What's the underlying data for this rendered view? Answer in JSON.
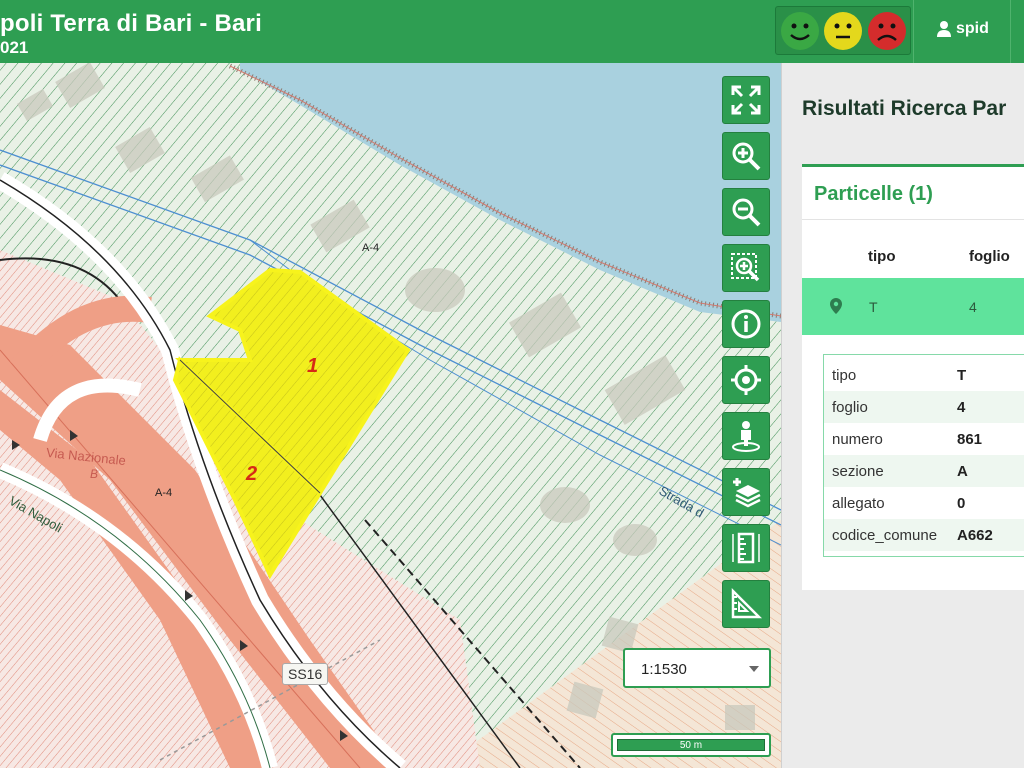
{
  "header": {
    "title": "poli Terra di Bari - Bari",
    "subtitle": "021",
    "user_label": "spid",
    "feedback": {
      "good_color": "#3aa844",
      "neutral_color": "#e4d81c",
      "bad_color": "#d42c2c"
    }
  },
  "map": {
    "labels": {
      "zone_a4_top": "A-4",
      "zone_a4_left": "A-4",
      "via_nazionale": "Via Nazionale",
      "via_nazionale_b": "B",
      "via_napoli": "Via Napoli",
      "strada": "Strada d",
      "road_badge": "SS16"
    },
    "parcels": [
      {
        "number": "1",
        "fill": "#f2ef1e"
      },
      {
        "number": "2",
        "fill": "#f2ef1e"
      }
    ],
    "tools": [
      {
        "name": "fullscreen",
        "icon": "expand-icon"
      },
      {
        "name": "zoom-in",
        "icon": "zoom-in-icon"
      },
      {
        "name": "zoom-out",
        "icon": "zoom-out-icon"
      },
      {
        "name": "zoom-selection",
        "icon": "zoom-box-icon"
      },
      {
        "name": "info",
        "icon": "info-icon"
      },
      {
        "name": "locate",
        "icon": "locate-icon"
      },
      {
        "name": "street-view",
        "icon": "person-pin-icon"
      },
      {
        "name": "add-layer",
        "icon": "layers-add-icon"
      },
      {
        "name": "measure-length",
        "icon": "ruler-icon"
      },
      {
        "name": "measure-area",
        "icon": "set-square-icon"
      }
    ],
    "scale_select": {
      "value": "1:1530"
    },
    "scale_bar": {
      "label": "50 m"
    }
  },
  "panel": {
    "title": "Risultati Ricerca Par",
    "card_title": "Particelle (1)",
    "columns": [
      "tipo",
      "foglio"
    ],
    "selected_row": {
      "tipo": "T",
      "foglio": "4"
    },
    "details": [
      {
        "key": "tipo",
        "value": "T"
      },
      {
        "key": "foglio",
        "value": "4"
      },
      {
        "key": "numero",
        "value": "861"
      },
      {
        "key": "sezione",
        "value": "A"
      },
      {
        "key": "allegato",
        "value": "0"
      },
      {
        "key": "codice_comune",
        "value": "A662"
      }
    ]
  },
  "colors": {
    "brand_green": "#2e9e52",
    "selected_row": "#5fe39c",
    "water": "#a9d1df"
  }
}
